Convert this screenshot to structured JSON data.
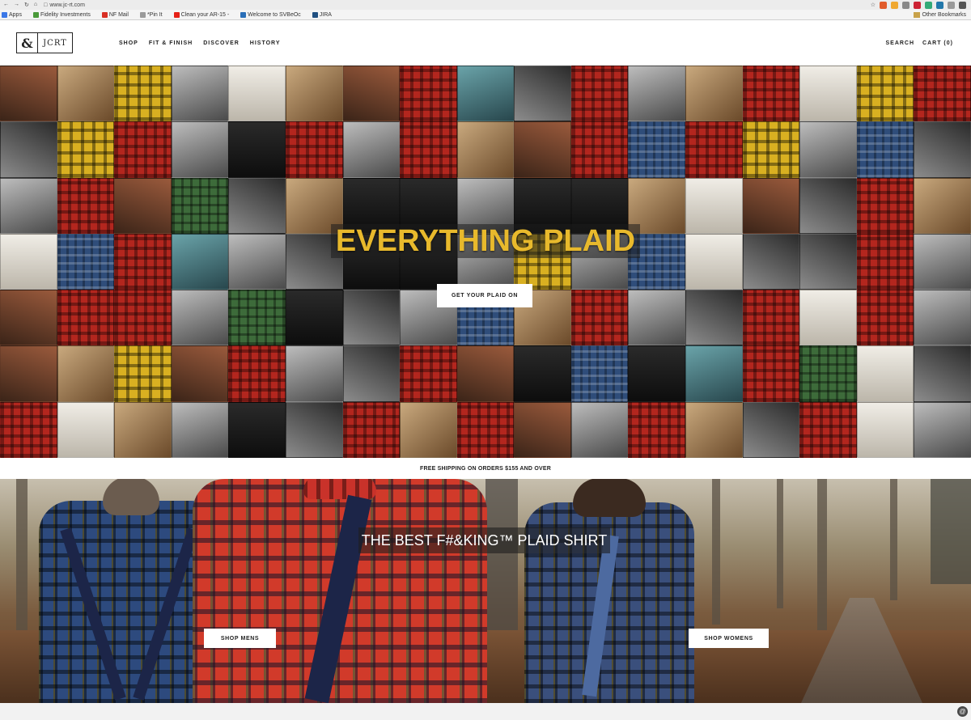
{
  "browser": {
    "url": "www.jc-rt.com",
    "bookmarks": [
      {
        "label": "Apps",
        "icon": "apps-icon",
        "color": "#3b78e7"
      },
      {
        "label": "Fidelity Investments",
        "icon": "fidelity-icon",
        "color": "#4a9a3a"
      },
      {
        "label": "NF Mail",
        "icon": "gmail-icon",
        "color": "#d93025"
      },
      {
        "label": "*Pin It",
        "icon": "page-icon",
        "color": "#9a9a9a"
      },
      {
        "label": "Clean your AR-15 -",
        "icon": "youtube-icon",
        "color": "#e62117"
      },
      {
        "label": "Welcome to SVBeOc",
        "icon": "svb-icon",
        "color": "#2a6fb8"
      },
      {
        "label": "JIRA",
        "icon": "jira-icon",
        "color": "#205081"
      }
    ],
    "other_bookmarks": "Other Bookmarks"
  },
  "header": {
    "logo_mark": "&",
    "logo_text": "JCRT",
    "nav": [
      "SHOP",
      "FIT & FINISH",
      "DISCOVER",
      "HISTORY"
    ],
    "search": "SEARCH",
    "cart": "CART (0)"
  },
  "hero": {
    "title": "EVERYTHING PLAID",
    "title_color": "#e8b92c",
    "cta": "GET YOUR PLAID ON"
  },
  "shipping_banner": "FREE SHIPPING ON ORDERS $155 AND OVER",
  "feature": {
    "title": "THE BEST F#&KING™ PLAID SHIRT",
    "shop_mens": "SHOP MENS",
    "shop_womens": "SHOP WOMENS"
  }
}
